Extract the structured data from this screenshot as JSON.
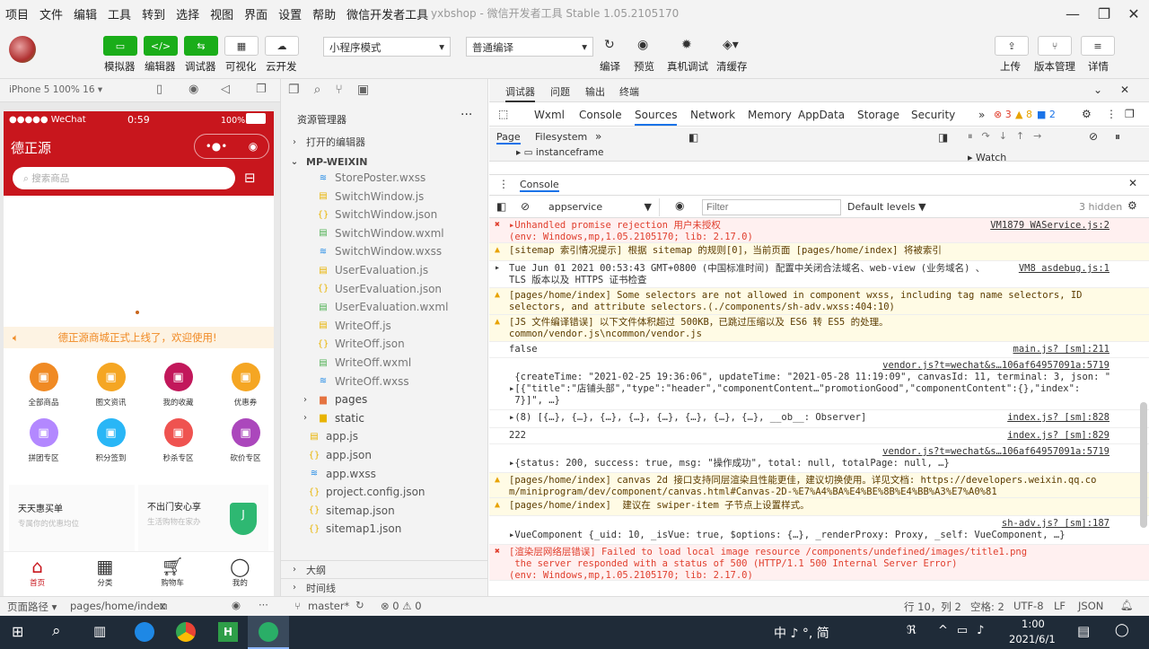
{
  "menu": [
    "项目",
    "文件",
    "编辑",
    "工具",
    "转到",
    "选择",
    "视图",
    "界面",
    "设置",
    "帮助",
    "微信开发者工具"
  ],
  "window_title": "yxbshop - 微信开发者工具 Stable 1.05.2105170",
  "toolbar": {
    "simulator": "模拟器",
    "editor": "编辑器",
    "debugger": "调试器",
    "visual": "可视化",
    "cloud": "云开发",
    "mode": "小程序模式",
    "compile_mode": "普通编译",
    "compile": "编译",
    "preview": "预览",
    "real_debug": "真机调试",
    "clear_cache": "清缓存",
    "upload": "上传",
    "version": "版本管理",
    "details": "详情"
  },
  "sim_header": "iPhone 5 100% 16 ▾",
  "phone": {
    "carrier": "●●●●● WeChat",
    "time": "0:59",
    "battery": "100%",
    "title": "德正源",
    "search_placeholder": "搜索商品",
    "notice": "德正源商城正式上线了，欢迎使用!",
    "categories": [
      {
        "label": "全部商品",
        "color": "#f08a24"
      },
      {
        "label": "图文资讯",
        "color": "#f5a623"
      },
      {
        "label": "我的收藏",
        "color": "#c2185b"
      },
      {
        "label": "优惠券",
        "color": "#f5a623"
      },
      {
        "label": "拼团专区",
        "color": "#b388ff"
      },
      {
        "label": "积分签到",
        "color": "#29b6f6"
      },
      {
        "label": "秒杀专区",
        "color": "#ef5350"
      },
      {
        "label": "砍价专区",
        "color": "#ab47bc"
      }
    ],
    "promo1_title": "天天惠买单",
    "promo1_sub": "专属你的优惠均位",
    "promo2_title": "不出门安心享",
    "promo2_sub": "生活购物在家办",
    "tabbar": [
      "首页",
      "分类",
      "购物车",
      "我的"
    ]
  },
  "explorer": {
    "title": "资源管理器",
    "open_editors": "打开的编辑器",
    "root": "MP-WEIXIN",
    "files": [
      {
        "name": "StorePoster.wxss",
        "type": "wxss"
      },
      {
        "name": "SwitchWindow.js",
        "type": "js"
      },
      {
        "name": "SwitchWindow.json",
        "type": "json"
      },
      {
        "name": "SwitchWindow.wxml",
        "type": "wxml"
      },
      {
        "name": "SwitchWindow.wxss",
        "type": "wxss"
      },
      {
        "name": "UserEvaluation.js",
        "type": "js"
      },
      {
        "name": "UserEvaluation.json",
        "type": "json"
      },
      {
        "name": "UserEvaluation.wxml",
        "type": "wxml"
      },
      {
        "name": "WriteOff.js",
        "type": "js"
      },
      {
        "name": "WriteOff.json",
        "type": "json"
      },
      {
        "name": "WriteOff.wxml",
        "type": "wxml"
      },
      {
        "name": "WriteOff.wxss",
        "type": "wxss"
      }
    ],
    "folders": [
      "pages",
      "static"
    ],
    "root_files": [
      {
        "name": "app.js",
        "type": "js"
      },
      {
        "name": "app.json",
        "type": "json"
      },
      {
        "name": "app.wxss",
        "type": "wxss"
      },
      {
        "name": "project.config.json",
        "type": "json"
      },
      {
        "name": "sitemap.json",
        "type": "json"
      },
      {
        "name": "sitemap1.json",
        "type": "json"
      }
    ],
    "outline": "大纲",
    "timeline": "时间线"
  },
  "devtools": {
    "top_tabs": [
      "调试器",
      "问题",
      "输出",
      "终端"
    ],
    "tabs": [
      "Wxml",
      "Console",
      "Sources",
      "Network",
      "Memory",
      "AppData",
      "Storage",
      "Security"
    ],
    "err_count": "3",
    "warn_count": "8",
    "info_count": "2",
    "page_tab": "Page",
    "fs_tab": "Filesystem",
    "tree_item": "instanceframe",
    "watch": "Watch",
    "console_tab": "Console",
    "context": "appservice",
    "filter_placeholder": "Filter",
    "levels": "Default levels ▼",
    "hidden": "3 hidden"
  },
  "logs": [
    {
      "kind": "err",
      "icon": "✖",
      "text": "▸Unhandled promise rejection 用户未授权\n(env: Windows,mp,1.05.2105170; lib: 2.17.0)",
      "src": "VM1879 WAService.js:2",
      "h": 28
    },
    {
      "kind": "warn",
      "icon": "▲",
      "text": "[sitemap 索引情况提示] 根据 sitemap 的规则[0]，当前页面 [pages/home/index] 将被索引",
      "src": "",
      "h": 20
    },
    {
      "kind": "",
      "icon": "▸",
      "text": "Tue Jun 01 2021 00:53:43 GMT+0800 (中国标准时间) 配置中关闭合法域名、web-view (业务域名) 、\nTLS 版本以及 HTTPS 证书检查",
      "src": "VM8 asdebug.js:1",
      "h": 30
    },
    {
      "kind": "warn",
      "icon": "▲",
      "text": "[pages/home/index] Some selectors are not allowed in component wxss, including tag name selectors, ID\nselectors, and attribute selectors.(./components/sh-adv.wxss:404:10)",
      "src": "",
      "h": 30
    },
    {
      "kind": "warn",
      "icon": "▲",
      "text": "[JS 文件编译错误] 以下文件体积超过 500KB，已跳过压缩以及 ES6 转 ES5 的处理。\ncommon/vendor.js\\ncommon/vendor.js",
      "src": "",
      "h": 30
    },
    {
      "kind": "",
      "icon": "",
      "text": "false",
      "src": "main.js? [sm]:211",
      "h": 18
    },
    {
      "kind": "",
      "icon": "",
      "text": "\n {createTime: \"2021-02-25 19:36:06\", updateTime: \"2021-05-28 11:19:09\", canvasId: 11, terminal: 3, json: \"\n▸[{\"title\":\"店铺头部\",\"type\":\"header\",\"componentContent…\"promotionGood\",\"componentContent\":{},\"index\":\n 7}]\", …}",
      "src": "vendor.js?t=wechat&s…106af64957091a:5719",
      "h": 58
    },
    {
      "kind": "",
      "icon": "",
      "text": "▸(8) [{…}, {…}, {…}, {…}, {…}, {…}, {…}, {…}, __ob__: Observer]",
      "src": "index.js? [sm]:828",
      "h": 20
    },
    {
      "kind": "",
      "icon": "",
      "text": "222",
      "src": "index.js? [sm]:829",
      "h": 18
    },
    {
      "kind": "",
      "icon": "",
      "text": "\n▸{status: 200, success: true, msg: \"操作成功\", total: null, totalPage: null, …}",
      "src": "vendor.js?t=wechat&s…106af64957091a:5719",
      "h": 32
    },
    {
      "kind": "warn",
      "icon": "▲",
      "text": "[pages/home/index] canvas 2d 接口支持同层渲染且性能更佳，建议切换使用。详见文档: https://developers.weixin.qq.co\nm/miniprogram/dev/component/canvas.html#Canvas-2D-%E7%A4%BA%E4%BE%8B%E4%BB%A3%E7%A0%81",
      "src": "",
      "h": 28
    },
    {
      "kind": "warn",
      "icon": "▲",
      "text": "[pages/home/index]  建议在 swiper-item 子节点上设置样式。",
      "src": "",
      "h": 20
    },
    {
      "kind": "",
      "icon": "",
      "text": "\n▸VueComponent {_uid: 10, _isVue: true, $options: {…}, _renderProxy: Proxy, _self: VueComponent, …}",
      "src": "sh-adv.js? [sm]:187",
      "h": 32
    },
    {
      "kind": "err",
      "icon": "✖",
      "text": "[渲染层网络层错误] Failed to load local image resource /components/undefined/images/title1.png\n the server responded with a status of 500 (HTTP/1.1 500 Internal Server Error)\n(env: Windows,mp,1.05.2105170; lib: 2.17.0)",
      "src": "",
      "h": 40
    }
  ],
  "statusbar": {
    "page_path_label": "页面路径 ▾",
    "page_path": "pages/home/index",
    "branch": "master*",
    "problems": "⊗ 0 ⚠ 0",
    "position": "行 10，列 2",
    "spaces": "空格: 2",
    "encoding": "UTF-8",
    "eol": "LF",
    "lang": "JSON"
  },
  "taskbar": {
    "ime": "中 ♪ °, 简",
    "time": "1:00",
    "date": "2021/6/1"
  }
}
